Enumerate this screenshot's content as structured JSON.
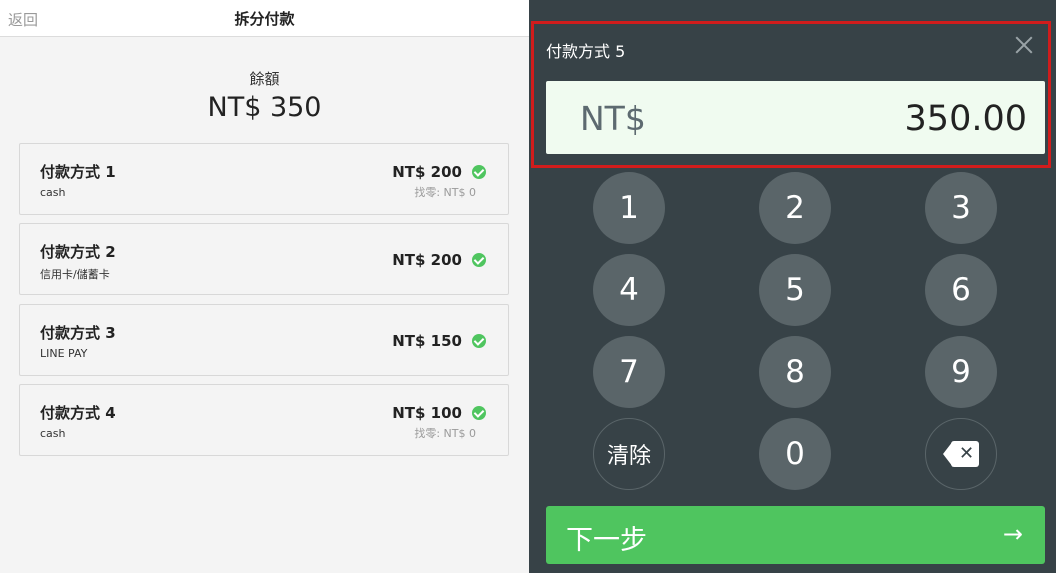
{
  "header": {
    "back_label": "返回",
    "title": "拆分付款"
  },
  "balance": {
    "label": "餘額",
    "amount": "NT$ 350"
  },
  "payments": [
    {
      "name": "付款方式 1",
      "method": "cash",
      "amount": "NT$ 200",
      "change": "找零: NT$ 0",
      "status": "paid"
    },
    {
      "name": "付款方式 2",
      "method": "信用卡/儲蓄卡",
      "amount": "NT$ 200",
      "change": "",
      "status": "paid"
    },
    {
      "name": "付款方式 3",
      "method": "LINE PAY",
      "amount": "NT$ 150",
      "change": "",
      "status": "paid"
    },
    {
      "name": "付款方式 4",
      "method": "cash",
      "amount": "NT$ 100",
      "change": "找零: NT$ 0",
      "status": "paid"
    }
  ],
  "entry": {
    "title": "付款方式 5",
    "currency": "NT$",
    "value": "350.00"
  },
  "keypad": {
    "keys": [
      "1",
      "2",
      "3",
      "4",
      "5",
      "6",
      "7",
      "8",
      "9"
    ],
    "clear_label": "清除",
    "zero_label": "0",
    "backspace_icon": "backspace-icon"
  },
  "next": {
    "label": "下一步",
    "icon": "arrow-right-icon"
  },
  "colors": {
    "accent": "#4fc55f",
    "panel": "#374247",
    "key": "#5a6569",
    "highlight": "#d11c1c"
  }
}
